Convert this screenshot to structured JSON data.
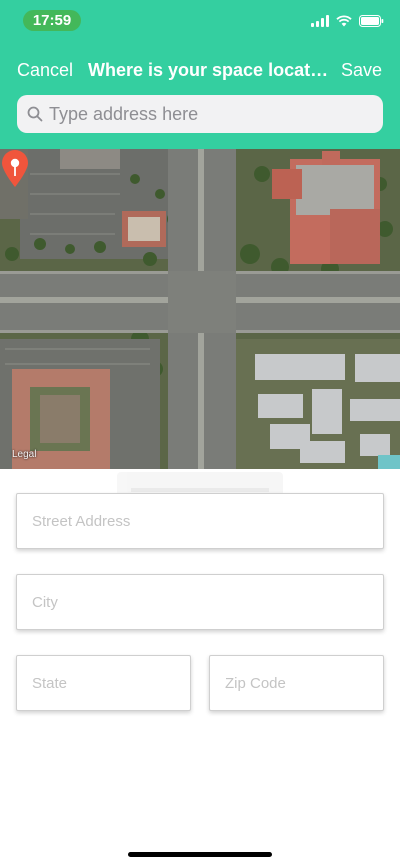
{
  "status_bar": {
    "time": "17:59"
  },
  "nav": {
    "cancel_label": "Cancel",
    "title": "Where is your space located?",
    "save_label": "Save"
  },
  "search": {
    "placeholder": "Type address here"
  },
  "map": {
    "legal_label": "Legal"
  },
  "form": {
    "street_placeholder": "Street Address",
    "city_placeholder": "City",
    "state_placeholder": "State",
    "zip_placeholder": "Zip Code"
  },
  "colors": {
    "header": "#34cfa0",
    "time_pill": "#43b85a",
    "pin": "#f0553c"
  }
}
